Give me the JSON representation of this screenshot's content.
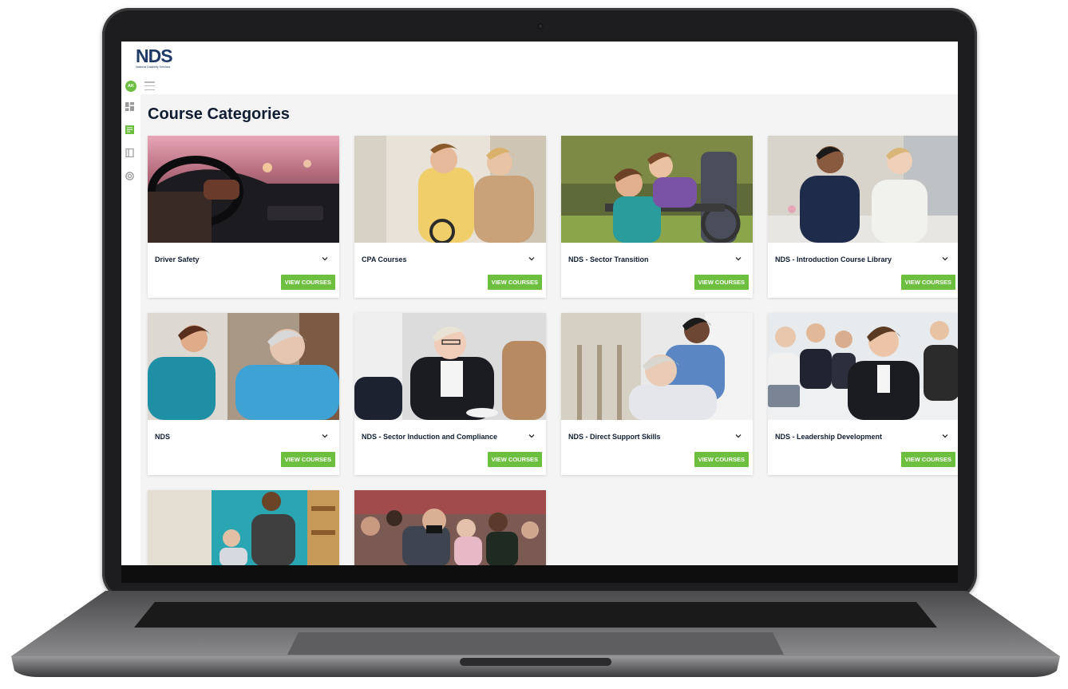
{
  "app": {
    "logo_text": "NDS",
    "logo_subtitle": "National Disability Services",
    "avatar_initials": "AK"
  },
  "page": {
    "title": "Course Categories"
  },
  "categories": [
    {
      "name": "Driver Safety",
      "button": "VIEW COURSES"
    },
    {
      "name": "CPA Courses",
      "button": "VIEW COURSES"
    },
    {
      "name": "NDS - Sector Transition",
      "button": "VIEW COURSES"
    },
    {
      "name": "NDS - Introduction Course Library",
      "button": "VIEW COURSES"
    },
    {
      "name": "NDS",
      "button": "VIEW COURSES"
    },
    {
      "name": "NDS - Sector Induction and Compliance",
      "button": "VIEW COURSES"
    },
    {
      "name": "NDS - Direct Support Skills",
      "button": "VIEW COURSES"
    },
    {
      "name": "NDS - Leadership Development",
      "button": "VIEW COURSES"
    }
  ],
  "icons": {
    "menu": "hamburger-menu-icon",
    "dashboard": "dashboard-icon",
    "courses": "courses-icon",
    "library": "book-icon",
    "support": "support-icon",
    "expand": "chevron-down-icon"
  },
  "colors": {
    "accent": "#6cbf3f",
    "brand_navy": "#1f3a66",
    "title": "#0f1d33"
  }
}
